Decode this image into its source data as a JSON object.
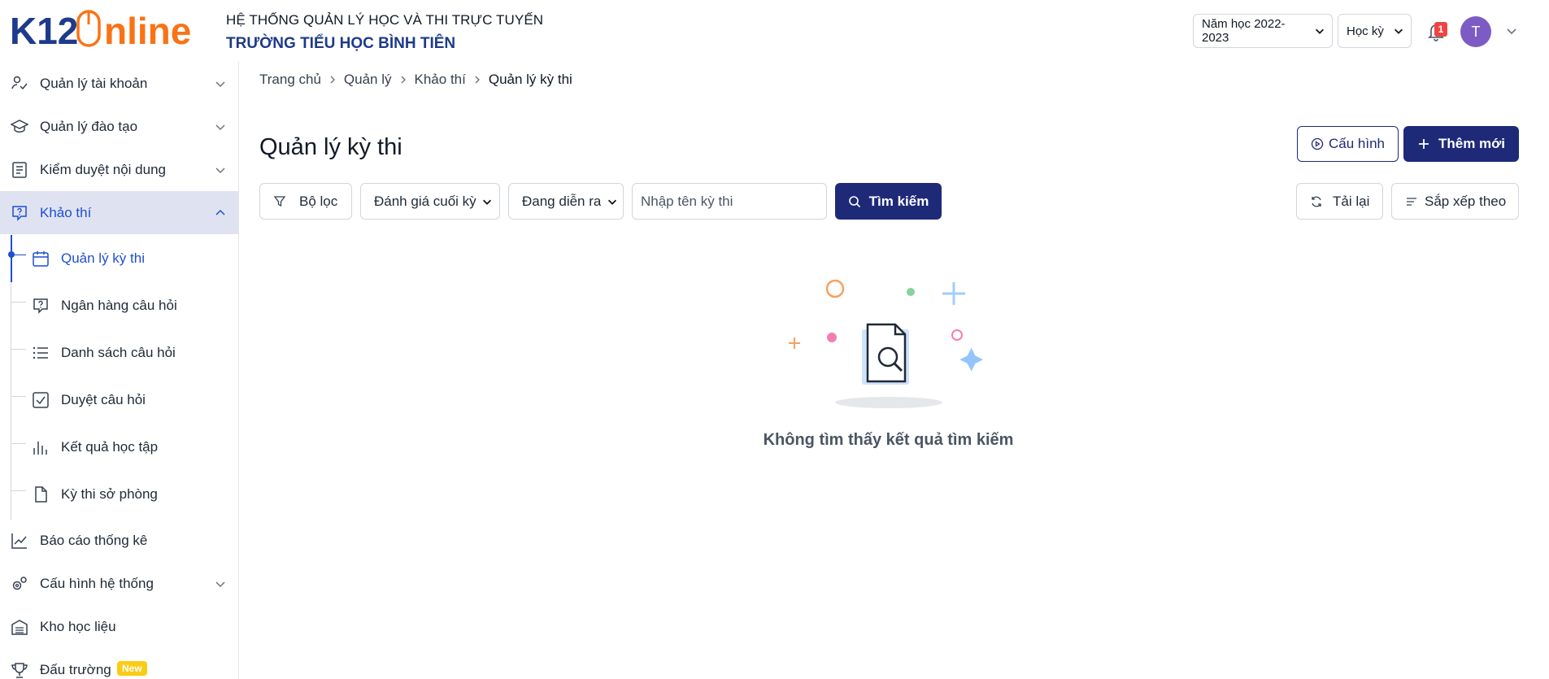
{
  "header": {
    "logo_text_k": "K12",
    "logo_text_o": "nline",
    "system_title": "HỆ THỐNG QUẢN LÝ HỌC VÀ THI TRỰC TUYẾN",
    "school_name": "TRƯỜNG TIỂU HỌC BÌNH TIÊN",
    "school_year": "Năm học 2022-2023",
    "term": "Học kỳ II",
    "notification_count": "1",
    "avatar_initial": "T"
  },
  "sidebar": {
    "items": [
      {
        "label": "Quản lý tài khoản",
        "icon": "user-check-icon"
      },
      {
        "label": "Quản lý đào tạo",
        "icon": "graduation-cap-icon"
      },
      {
        "label": "Kiểm duyệt nội dung",
        "icon": "document-list-icon"
      },
      {
        "label": "Khảo thí",
        "icon": "question-bubble-icon",
        "active": true
      },
      {
        "label": "Báo cáo thống kê",
        "icon": "trend-chart-icon"
      },
      {
        "label": "Cấu hình hệ thống",
        "icon": "gears-icon"
      },
      {
        "label": "Kho học liệu",
        "icon": "warehouse-icon"
      },
      {
        "label": "Đấu trường",
        "icon": "trophy-icon",
        "badge": "New"
      }
    ],
    "sub_items": [
      {
        "label": "Quản lý kỳ thi",
        "icon": "calendar-icon",
        "active": true
      },
      {
        "label": "Ngân hàng câu hỏi",
        "icon": "question-bubble-icon"
      },
      {
        "label": "Danh sách câu hỏi",
        "icon": "list-icon"
      },
      {
        "label": "Duyệt câu hỏi",
        "icon": "checkbox-icon"
      },
      {
        "label": "Kết quả học tập",
        "icon": "bar-chart-icon"
      },
      {
        "label": "Kỳ thi sở phòng",
        "icon": "file-icon"
      }
    ]
  },
  "breadcrumb": [
    "Trang chủ",
    "Quản lý",
    "Khảo thí",
    "Quản lý kỳ thi"
  ],
  "main": {
    "title": "Quản lý kỳ thi",
    "config_button": "Cấu hình",
    "add_button": "Thêm mới",
    "filter_button": "Bộ lọc",
    "type_select": "Đánh giá cuối kỳ",
    "status_select": "Đang diễn ra",
    "search_placeholder": "Nhập tên kỳ thi",
    "search_button": "Tìm kiếm",
    "reload_button": "Tải lại",
    "sort_button": "Sắp xếp theo",
    "empty_message": "Không tìm thấy kết quả tìm kiếm"
  },
  "colors": {
    "primary": "#1e2a78",
    "active_bg": "#dfe3f1",
    "active_text": "#1e4fd0",
    "logo_blue": "#1e3a8a",
    "logo_orange": "#f97316"
  }
}
